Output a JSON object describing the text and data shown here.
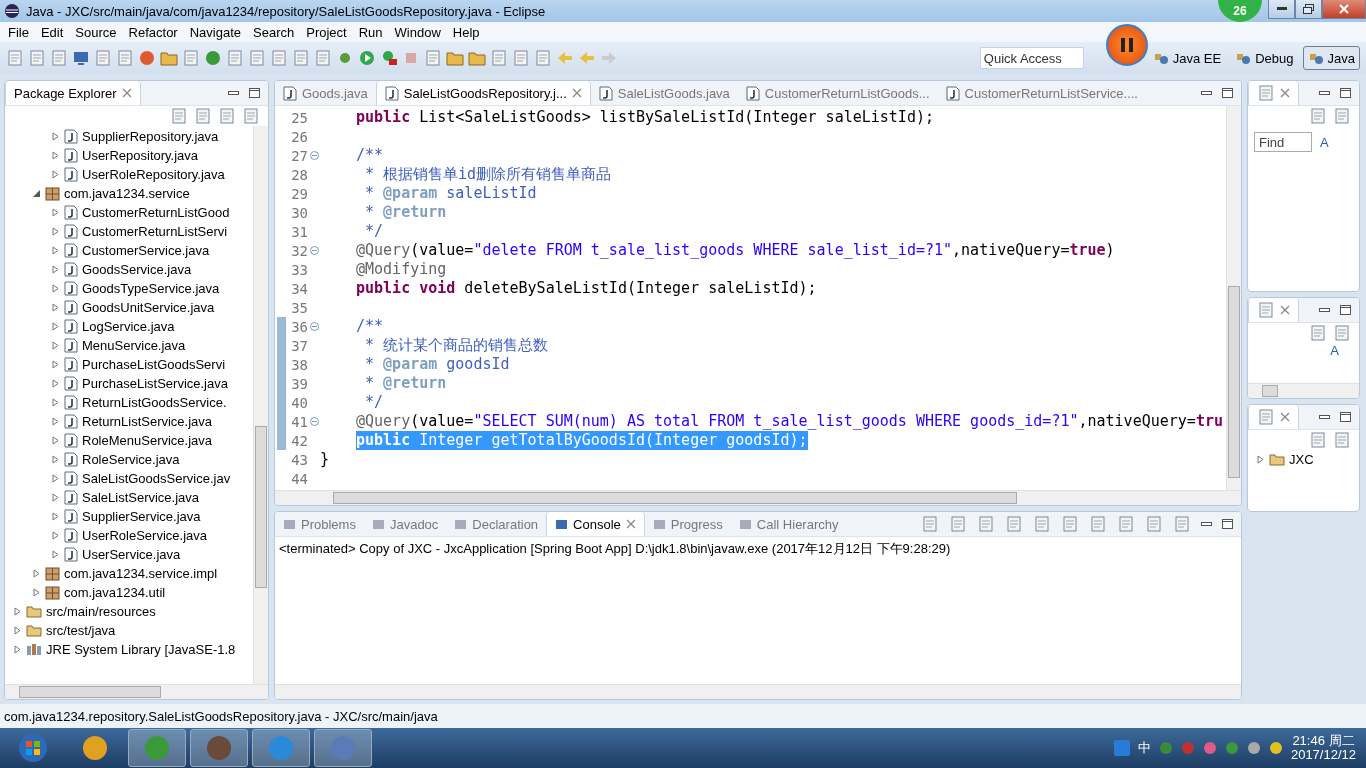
{
  "window": {
    "title": "Java - JXC/src/main/java/com/java1234/repository/SaleListGoodsRepository.java - Eclipse"
  },
  "recorder_badge": "26",
  "menu": [
    "File",
    "Edit",
    "Source",
    "Refactor",
    "Navigate",
    "Search",
    "Project",
    "Run",
    "Window",
    "Help"
  ],
  "quick_access": {
    "placeholder": "Quick Access"
  },
  "perspectives": [
    {
      "label": "Java EE",
      "selected": false
    },
    {
      "label": "Debug",
      "selected": false
    },
    {
      "label": "Java",
      "selected": true
    }
  ],
  "package_explorer": {
    "title": "Package Explorer",
    "tree": [
      {
        "children": [
          {
            "children": [
              {
                "label": "SupplierRepository.java",
                "kind": "file",
                "expanded": false
              },
              {
                "label": "UserRepository.java",
                "kind": "file",
                "expanded": false
              },
              {
                "label": "UserRoleRepository.java",
                "kind": "file",
                "expanded": false
              }
            ]
          },
          {
            "label": "com.java1234.service",
            "kind": "package",
            "expanded": true,
            "children": [
              {
                "label": "CustomerReturnListGood",
                "kind": "file",
                "expanded": false
              },
              {
                "label": "CustomerReturnListServi",
                "kind": "file",
                "expanded": false
              },
              {
                "label": "CustomerService.java",
                "kind": "file",
                "expanded": false
              },
              {
                "label": "GoodsService.java",
                "kind": "file",
                "expanded": false
              },
              {
                "label": "GoodsTypeService.java",
                "kind": "file",
                "expanded": false
              },
              {
                "label": "GoodsUnitService.java",
                "kind": "file",
                "expanded": false
              },
              {
                "label": "LogService.java",
                "kind": "file",
                "expanded": false
              },
              {
                "label": "MenuService.java",
                "kind": "file",
                "expanded": false
              },
              {
                "label": "PurchaseListGoodsServi",
                "kind": "file",
                "expanded": false
              },
              {
                "label": "PurchaseListService.java",
                "kind": "file",
                "expanded": false
              },
              {
                "label": "ReturnListGoodsService.",
                "kind": "file",
                "expanded": false
              },
              {
                "label": "ReturnListService.java",
                "kind": "file",
                "expanded": false
              },
              {
                "label": "RoleMenuService.java",
                "kind": "file",
                "expanded": false
              },
              {
                "label": "RoleService.java",
                "kind": "file",
                "expanded": false
              },
              {
                "label": "SaleListGoodsService.jav",
                "kind": "file",
                "expanded": false
              },
              {
                "label": "SaleListService.java",
                "kind": "file",
                "expanded": false
              },
              {
                "label": "SupplierService.java",
                "kind": "file",
                "expanded": false
              },
              {
                "label": "UserRoleService.java",
                "kind": "file",
                "expanded": false
              },
              {
                "label": "UserService.java",
                "kind": "file",
                "expanded": false
              }
            ]
          },
          {
            "label": "com.java1234.service.impl",
            "kind": "package",
            "expanded": false
          },
          {
            "label": "com.java1234.util",
            "kind": "package",
            "expanded": false
          }
        ]
      },
      {
        "label": "src/main/resources",
        "kind": "folder",
        "expanded": false
      },
      {
        "label": "src/test/java",
        "kind": "folder",
        "expanded": false
      },
      {
        "label": "JRE System Library [JavaSE-1.8",
        "kind": "library",
        "expanded": false
      }
    ]
  },
  "editor_tabs": [
    {
      "label": "Goods.java",
      "selected": false
    },
    {
      "label": "SaleListGoodsRepository.j...",
      "selected": true
    },
    {
      "label": "SaleListGoods.java",
      "selected": false
    },
    {
      "label": "CustomerReturnListGoods...",
      "selected": false
    },
    {
      "label": "CustomerReturnListService....",
      "selected": false
    }
  ],
  "code_lines": [
    {
      "number": "25",
      "fold": false,
      "changed": false,
      "selected": false,
      "segments": [
        {
          "kind": "keyword",
          "text": "public"
        },
        {
          "kind": "plain",
          "text": " List<SaleListGoods> listBySaleListId(Integer saleListId);"
        }
      ]
    },
    {
      "number": "26",
      "fold": false,
      "changed": false,
      "selected": false
    },
    {
      "number": "27",
      "fold": true,
      "changed": false,
      "selected": false,
      "segments": [
        {
          "kind": "doc",
          "text": "/**"
        }
      ]
    },
    {
      "number": "28",
      "fold": false,
      "changed": false,
      "selected": false,
      "segments": [
        {
          "kind": "doc",
          "text": " * 根据销售单id删除所有销售单商品"
        }
      ]
    },
    {
      "number": "29",
      "fold": false,
      "changed": false,
      "selected": false,
      "segments": [
        {
          "kind": "doc",
          "text": " * "
        },
        {
          "kind": "tag",
          "text": "@param"
        },
        {
          "kind": "doc",
          "text": " saleListId"
        }
      ]
    },
    {
      "number": "30",
      "fold": false,
      "changed": false,
      "selected": false,
      "segments": [
        {
          "kind": "doc",
          "text": " * "
        },
        {
          "kind": "tag",
          "text": "@return"
        }
      ]
    },
    {
      "number": "31",
      "fold": false,
      "changed": false,
      "selected": false,
      "segments": [
        {
          "kind": "doc",
          "text": " */"
        }
      ]
    },
    {
      "number": "32",
      "fold": true,
      "changed": false,
      "selected": false,
      "segments": [
        {
          "kind": "annotation",
          "text": "@Query"
        },
        {
          "kind": "plain",
          "text": "(value="
        },
        {
          "kind": "string",
          "text": "\"delete FROM t_sale_list_goods WHERE sale_list_id=?1\""
        },
        {
          "kind": "plain",
          "text": ",nativeQuery="
        },
        {
          "kind": "keyword",
          "text": "true"
        },
        {
          "kind": "plain",
          "text": ")"
        }
      ]
    },
    {
      "number": "33",
      "fold": false,
      "changed": false,
      "selected": false,
      "segments": [
        {
          "kind": "annotation",
          "text": "@Modifying"
        }
      ]
    },
    {
      "number": "34",
      "fold": false,
      "changed": false,
      "selected": false,
      "segments": [
        {
          "kind": "keyword",
          "text": "public void"
        },
        {
          "kind": "plain",
          "text": " deleteBySaleListId(Integer saleListId);"
        }
      ]
    },
    {
      "number": "35",
      "fold": false,
      "changed": false,
      "selected": false
    },
    {
      "number": "36",
      "fold": true,
      "changed": true,
      "selected": false,
      "segments": [
        {
          "kind": "doc",
          "text": "/**"
        }
      ]
    },
    {
      "number": "37",
      "fold": false,
      "changed": true,
      "selected": false,
      "segments": [
        {
          "kind": "doc",
          "text": " * 统计某个商品的销售总数"
        }
      ]
    },
    {
      "number": "38",
      "fold": false,
      "changed": true,
      "selected": false,
      "segments": [
        {
          "kind": "doc",
          "text": " * "
        },
        {
          "kind": "tag",
          "text": "@param"
        },
        {
          "kind": "doc",
          "text": " goodsId"
        }
      ]
    },
    {
      "number": "39",
      "fold": false,
      "changed": true,
      "selected": false,
      "segments": [
        {
          "kind": "doc",
          "text": " * "
        },
        {
          "kind": "tag",
          "text": "@return"
        }
      ]
    },
    {
      "number": "40",
      "fold": false,
      "changed": true,
      "selected": false,
      "segments": [
        {
          "kind": "doc",
          "text": " */"
        }
      ]
    },
    {
      "number": "41",
      "fold": true,
      "changed": true,
      "selected": false,
      "segments": [
        {
          "kind": "annotation",
          "text": "@Query"
        },
        {
          "kind": "plain",
          "text": "(value="
        },
        {
          "kind": "string",
          "text": "\"SELECT SUM(num) AS total FROM t_sale_list_goods WHERE goods_id=?1\""
        },
        {
          "kind": "plain",
          "text": ",nativeQuery="
        },
        {
          "kind": "keyword",
          "text": "tru"
        }
      ]
    },
    {
      "number": "42",
      "fold": false,
      "changed": true,
      "selected": true,
      "segments": [
        {
          "kind": "keyword",
          "text": "public"
        },
        {
          "kind": "plain",
          "text": " Integer getTotalByGoodsId(Integer goodsId);"
        }
      ]
    },
    {
      "number": "43",
      "fold": false,
      "changed": false,
      "selected": false,
      "outdented": true,
      "segments": [
        {
          "kind": "plain",
          "text": "}"
        }
      ]
    },
    {
      "number": "44",
      "fold": false,
      "changed": false,
      "selected": false
    }
  ],
  "bottom_tabs": [
    {
      "label": "Problems",
      "selected": false
    },
    {
      "label": "Javadoc",
      "selected": false
    },
    {
      "label": "Declaration",
      "selected": false
    },
    {
      "label": "Console",
      "selected": true
    },
    {
      "label": "Progress",
      "selected": false
    },
    {
      "label": "Call Hierarchy",
      "selected": false
    }
  ],
  "console": {
    "text": "<terminated> Copy of JXC - JxcApplication [Spring Boot App] D:\\jdk1.8\\bin\\javaw.exe (2017年12月12日 下午9:28:29)"
  },
  "task_panel": {
    "find": {
      "placeholder": "Find"
    },
    "filter_label": "A"
  },
  "outline_panel": {
    "label": "A"
  },
  "project_panel": {
    "root": {
      "label": "JXC",
      "expanded": false
    }
  },
  "status_bar": {
    "text": "com.java1234.repository.SaleListGoodsRepository.java - JXC/src/main/java"
  },
  "taskbar": {
    "ime": "中",
    "time": "21:46 周二",
    "date": "2017/12/12"
  }
}
